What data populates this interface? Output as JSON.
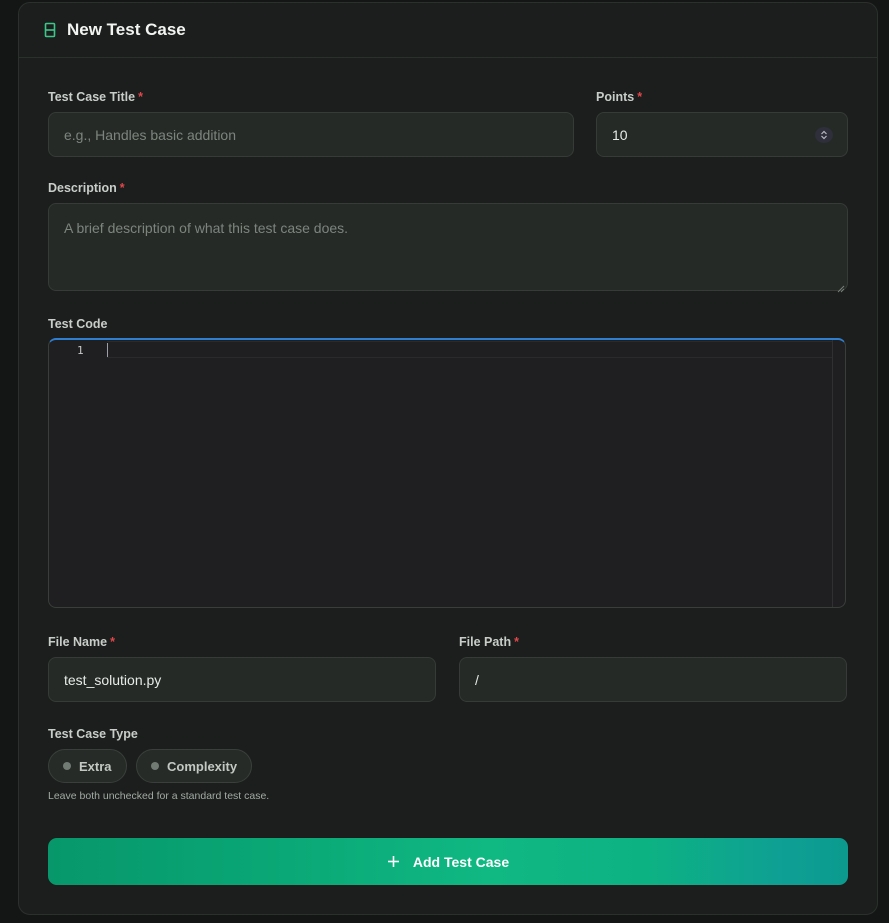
{
  "header": {
    "title": "New Test Case",
    "icon": "test-tube-icon",
    "accent": "#3ec58a"
  },
  "form": {
    "title_label": "Test Case Title",
    "title_placeholder": "e.g., Handles basic addition",
    "points_label": "Points",
    "points_value": "10",
    "description_label": "Description",
    "description_placeholder": "A brief description of what this test case does.",
    "code_label": "Test Code",
    "code_line_number": "1",
    "file_name_label": "File Name",
    "file_name_value": "test_solution.py",
    "file_path_label": "File Path",
    "file_path_value": "/",
    "type_label": "Test Case Type",
    "type_options": [
      "Extra",
      "Complexity"
    ],
    "hint": "Leave both unchecked for a standard test case.",
    "required_marker": "*"
  },
  "actions": {
    "submit_label": "Add Test Case",
    "submit_icon": "plus-icon"
  },
  "colors": {
    "required": "#e0474c",
    "editor_focus": "#2f7fd0",
    "button_start": "#07976a",
    "button_end": "#0c9a8e"
  }
}
